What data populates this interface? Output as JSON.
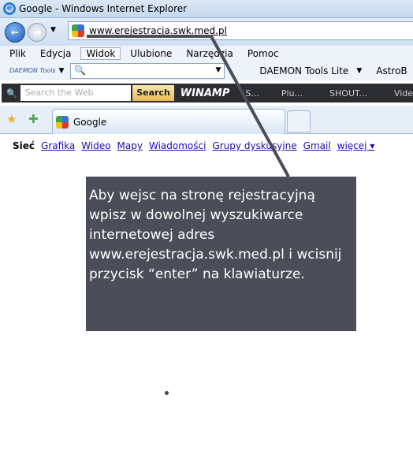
{
  "window": {
    "title": "Google - Windows Internet Explorer"
  },
  "address": {
    "url": "www.erejestracja.swk.med.pl"
  },
  "menu": [
    "Plik",
    "Edycja",
    "Widok",
    "Ulubione",
    "Narzędzia",
    "Pomoc"
  ],
  "toolbar1": {
    "daemon_logo": "DAEMON Tools",
    "daemon_lite": "DAEMON Tools Lite",
    "astro": "AstroB"
  },
  "toolbar2": {
    "search_placeholder": "Search the Web",
    "search_button": "Search",
    "winamp": "WINAMP",
    "items": [
      "S...",
      "Plu...",
      "SHOUT...",
      "Vide"
    ]
  },
  "tab": {
    "label": "Google"
  },
  "google_nav": [
    "Sieć",
    "Grafika",
    "Wideo",
    "Mapy",
    "Wiadomości",
    "Grupy dyskusyjne",
    "Gmail",
    "więcej ▾"
  ],
  "callout": {
    "text": "Aby wejsc na stronę rejestracyjną wpisz w dowolnej wyszukiwarce internetowej adres www.erejestracja.swk.med.pl i wcisnij przycisk “enter” na klawiaturze."
  }
}
